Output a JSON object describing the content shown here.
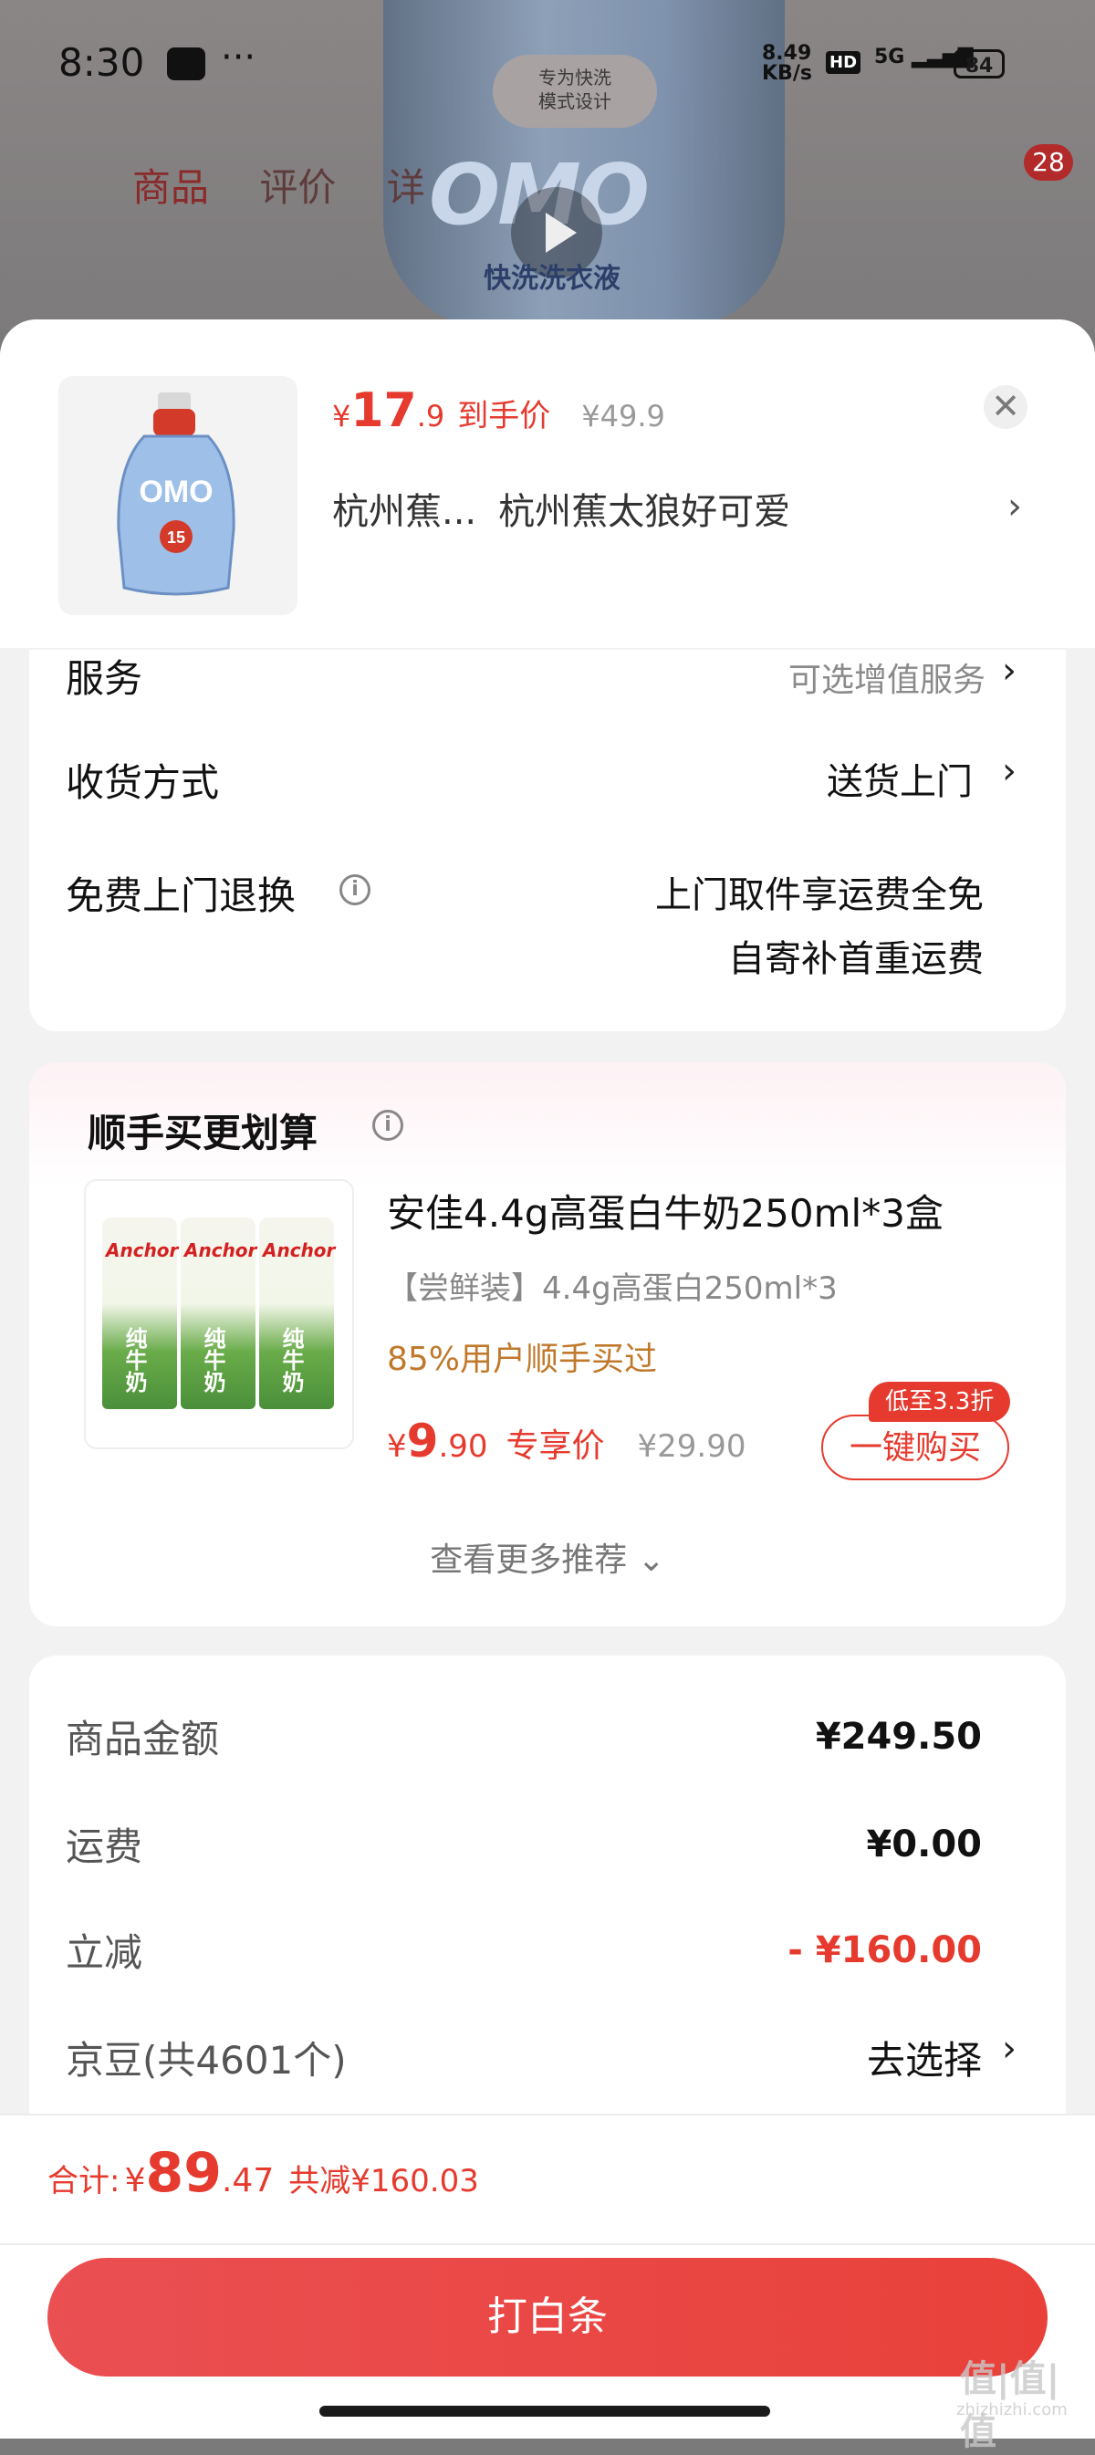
{
  "status_bar": {
    "time": "8:30",
    "dots": "···",
    "net_speed_value": "8.49",
    "net_speed_unit": "KB/s",
    "hd": "HD",
    "network": "5G",
    "battery": "84"
  },
  "background_page": {
    "tabs": [
      "商品",
      "评价",
      "详"
    ],
    "cart_count": "28",
    "badge_line1": "专为快洗",
    "badge_line2": "模式设计",
    "logo_text": "OMO",
    "product_sub": "快洗洗衣液"
  },
  "product": {
    "price_symbol": "¥",
    "price_int": "17",
    "price_dec": ".9",
    "price_label": "到手价",
    "original_price": "¥49.9",
    "spec_short": "杭州蕉...",
    "spec_full": "杭州蕉太狼好可爱",
    "close_symbol": "✕",
    "chevron": "›"
  },
  "services": {
    "service_label": "服务",
    "service_value": "可选增值服务",
    "delivery_label": "收货方式",
    "delivery_value": "送货上门",
    "return_label": "免费上门退换",
    "return_line1": "上门取件享运费全免",
    "return_line2": "自寄补首重运费",
    "info_symbol": "i",
    "chevron": "›"
  },
  "upsell": {
    "title": "顺手买更划算",
    "name": "安佳4.4g高蛋白牛奶250ml*3盒",
    "spec": "【尝鲜装】4.4g高蛋白250ml*3",
    "buyers": "85%用户顺手买过",
    "price_symbol": "¥",
    "price_int": "9",
    "price_dec": ".90",
    "price_label": "专享价",
    "original_price": "¥29.90",
    "buy_button": "一键购买",
    "discount_tag": "低至3.3折",
    "more": "查看更多推荐 ⌄",
    "carton_brand": "Anchor",
    "carton_text": "纯牛奶"
  },
  "summary": {
    "rows": [
      {
        "label": "商品金额",
        "value": "¥249.50"
      },
      {
        "label": "运费",
        "value": "¥0.00"
      },
      {
        "label": "立减",
        "value": "- ¥160.00"
      },
      {
        "label": "京豆(共4601个)",
        "value": "去选择"
      }
    ],
    "chevron": "›"
  },
  "footer": {
    "total_label": "合计:",
    "total_symbol": "¥",
    "total_int": "89",
    "total_dec": ".47",
    "total_saving": "共减¥160.03",
    "pay_button": "打白条"
  },
  "watermark": {
    "main": "值|值|值",
    "sub": "zhizhizhi.com"
  },
  "colors": {
    "accent": "#e63a2e",
    "buyers": "#c0792b",
    "muted": "#8a8a8a"
  }
}
